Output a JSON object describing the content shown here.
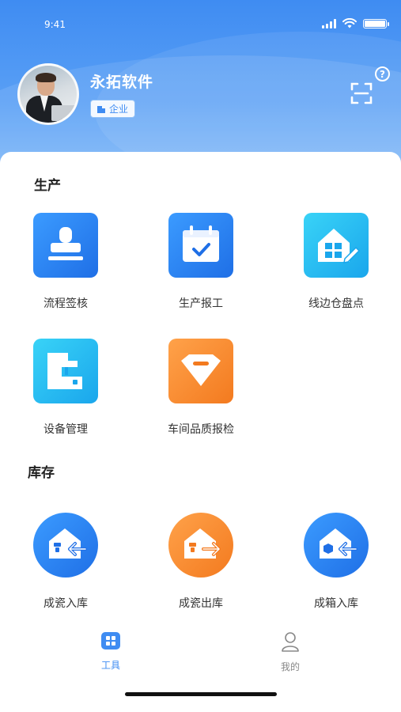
{
  "status_bar": {
    "time": "9:41"
  },
  "profile": {
    "name": "永拓软件",
    "badge": "企业"
  },
  "header": {
    "help_symbol": "?"
  },
  "sections": [
    {
      "title": "生产",
      "items": [
        {
          "label": "流程签核",
          "icon": "stamp-icon"
        },
        {
          "label": "生产报工",
          "icon": "calendar-check-icon"
        },
        {
          "label": "线边仓盘点",
          "icon": "warehouse-edit-icon"
        },
        {
          "label": "设备管理",
          "icon": "machine-icon"
        },
        {
          "label": "车间品质报检",
          "icon": "diamond-icon"
        }
      ]
    },
    {
      "title": "库存",
      "items": [
        {
          "label": "成瓷入库",
          "icon": "stock-in-icon"
        },
        {
          "label": "成瓷出库",
          "icon": "stock-out-icon"
        },
        {
          "label": "成箱入库",
          "icon": "box-in-icon"
        }
      ]
    }
  ],
  "tabbar": {
    "tools": "工具",
    "mine": "我的",
    "active": "工具"
  },
  "colors": {
    "accent": "#3f8cf2",
    "blue": "#1f6fe6",
    "cyan": "#1aa6ec",
    "orange": "#f37a1f",
    "inactive": "#888888"
  }
}
